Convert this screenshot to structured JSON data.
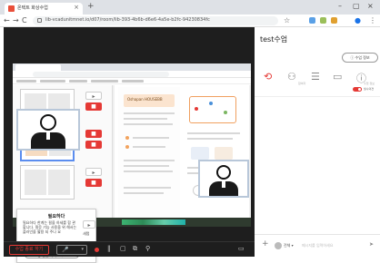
{
  "browser": {
    "tab_title": "온택트 화상수업",
    "url": "lib-vcadunitmnet.io/d07/room/lib-393-4b6b-d6e6-4a5e-b2fc-94230834fc",
    "close_glyph": "×",
    "new_tab_glyph": "+",
    "win_min": "–",
    "win_max": "▢",
    "win_close": "×"
  },
  "icons": {
    "back": "←",
    "forward": "→",
    "reload": "C",
    "star": "☆",
    "profile": "●",
    "menu": "⋮"
  },
  "room": {
    "class_title": "test수업",
    "class_info_button": "ⓘ 수업 정보",
    "nav_next": "›",
    "toggle_label": "필수의견"
  },
  "panel_tabs": [
    {
      "icon": "⟲",
      "label": ""
    },
    {
      "icon": "⚇",
      "label": "참여자"
    },
    {
      "icon": "☰",
      "label": ""
    },
    {
      "icon": "▭",
      "label": ""
    },
    {
      "icon": "ⓘ",
      "label": "수업 정보"
    }
  ],
  "shared_doc": {
    "header_text": "Oshapan HOUSEBB"
  },
  "share_popup": {
    "title": "필요하다",
    "body": "필요하다 한계는 필을 하세를 합 관할니다. 필응 기능 사용을 위 해서는 플러인을 활용 되 주나 요",
    "action_button": "● 열설 화리 : 1/4",
    "side_label": "새탭"
  },
  "controls": {
    "end_class": "수업 종료 하기",
    "mic_icon": "🎤",
    "mic_dropdown": "▾",
    "pause": "‖",
    "screen": "▢",
    "share": "⧉",
    "more": "⚲",
    "pip": "▭"
  },
  "chat": {
    "plus": "+",
    "recipient": "전체 ▾",
    "placeholder": "메시지를 입력하세요",
    "send": "➤"
  },
  "colors": {
    "accent_red": "#e53935",
    "dark_bg": "#1e1e1e",
    "thumb_active": "#5b8def"
  }
}
